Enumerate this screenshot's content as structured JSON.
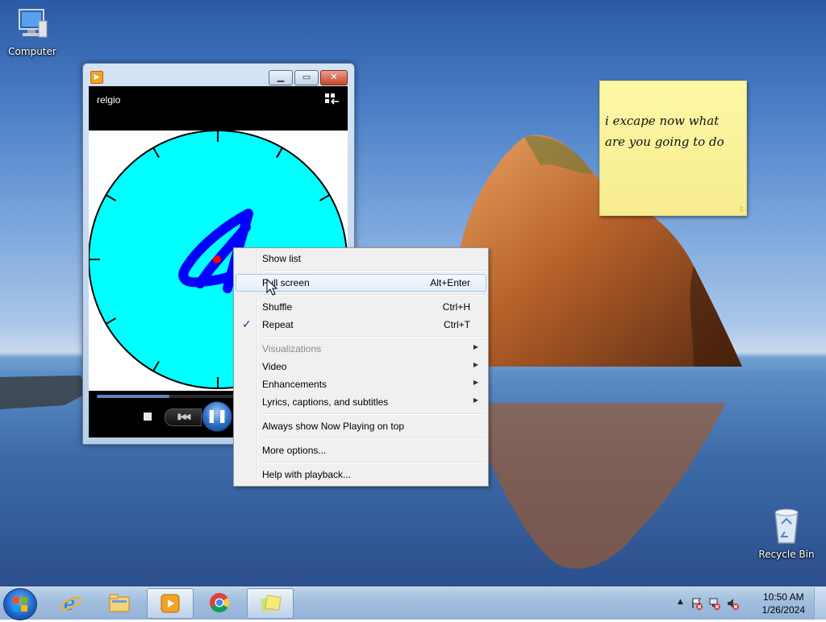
{
  "desktop": {
    "icons": [
      {
        "label": "Computer"
      },
      {
        "label": "Recycle Bin"
      }
    ]
  },
  "sticky_note": {
    "text": "i excape now what are you going to do"
  },
  "media_player": {
    "now_playing_title": "relgio",
    "progress": 0.3,
    "icon_names": [
      "media-player-app-icon",
      "minimize-icon",
      "maximize-icon",
      "close-icon",
      "switch-to-library-icon",
      "stop-icon",
      "previous-icon",
      "pause-icon"
    ]
  },
  "context_menu": {
    "items": [
      {
        "label": "Show list"
      },
      {
        "label": "Full screen",
        "shortcut": "Alt+Enter"
      },
      {
        "label": "Shuffle",
        "shortcut": "Ctrl+H"
      },
      {
        "label": "Repeat",
        "shortcut": "Ctrl+T",
        "checked": true
      },
      {
        "label": "Visualizations",
        "disabled": true
      },
      {
        "label": "Video"
      },
      {
        "label": "Enhancements"
      },
      {
        "label": "Lyrics, captions, and subtitles"
      },
      {
        "label": "Always show Now Playing on top"
      },
      {
        "label": "More options..."
      },
      {
        "label": "Help with playback..."
      }
    ],
    "checkmark": "✓",
    "submenu_arrow": "▶"
  },
  "taskbar": {
    "pinned": [
      "start-orb-icon",
      "internet-explorer-icon",
      "file-explorer-icon",
      "media-player-icon",
      "chrome-icon",
      "sticky-notes-icon"
    ],
    "clock": {
      "time": "10:50 AM",
      "date": "1/26/2024"
    }
  },
  "colors": {
    "viz_face": "#00ffff",
    "viz_digit": "#0000ff",
    "viz_dot": "#ff0000",
    "sticky": "#fdf7a6",
    "taskbar": "#a3bfdf"
  }
}
